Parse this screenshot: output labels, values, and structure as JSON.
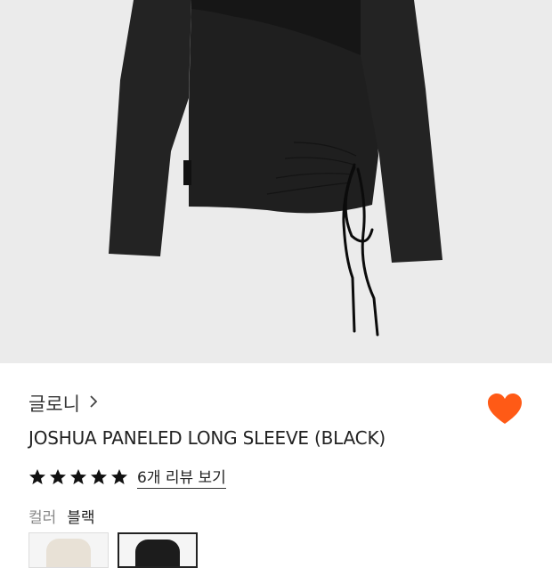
{
  "product": {
    "brand": "글로니",
    "name": "JOSHUA PANELED LONG SLEEVE (BLACK)",
    "review_link": "6개 리뷰 보기",
    "rating_stars": 5
  },
  "option": {
    "label": "컬러",
    "selected_value": "블랙",
    "swatches": [
      {
        "color": "#e8e1d6",
        "selected": false
      },
      {
        "color": "#1c1c1c",
        "selected": true
      }
    ]
  },
  "colors": {
    "hero_background": "#ebebeb",
    "garment": "#1e1e1e",
    "heart": "#ff5a16"
  },
  "icons": {
    "brand_chevron": "chevron-right-icon",
    "favorite": "heart-icon",
    "rating": "star-icon"
  }
}
